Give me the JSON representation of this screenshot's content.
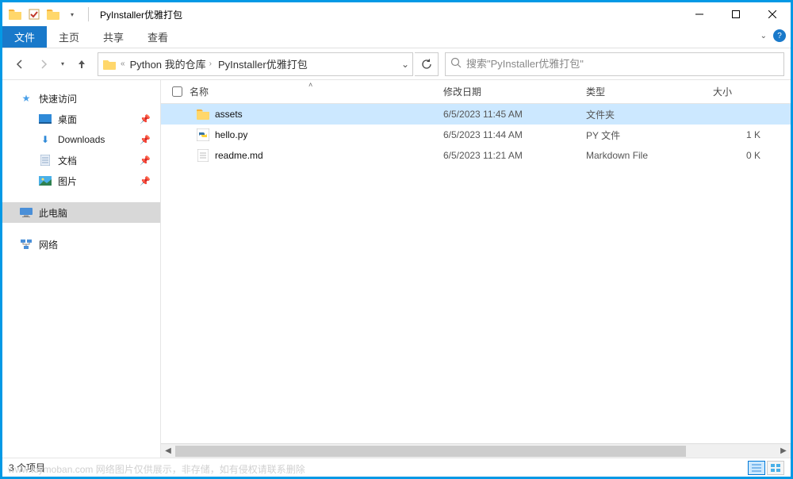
{
  "title": "PyInstaller优雅打包",
  "ribbon": {
    "file": "文件",
    "tabs": [
      "主页",
      "共享",
      "查看"
    ]
  },
  "breadcrumb": {
    "segments": [
      "Python 我的仓库",
      "PyInstaller优雅打包"
    ]
  },
  "search": {
    "placeholder": "搜索\"PyInstaller优雅打包\""
  },
  "sidebar": {
    "quick_access": "快速访问",
    "items_pinned": [
      "桌面",
      "Downloads",
      "文档",
      "图片"
    ],
    "this_pc": "此电脑",
    "network": "网络"
  },
  "columns": {
    "name": "名称",
    "date": "修改日期",
    "type": "类型",
    "size": "大小"
  },
  "rows": [
    {
      "name": "assets",
      "date": "6/5/2023 11:45 AM",
      "type": "文件夹",
      "size": "",
      "kind": "folder",
      "selected": true
    },
    {
      "name": "hello.py",
      "date": "6/5/2023 11:44 AM",
      "type": "PY 文件",
      "size": "1 K",
      "kind": "py",
      "selected": false
    },
    {
      "name": "readme.md",
      "date": "6/5/2023 11:21 AM",
      "type": "Markdown File",
      "size": "0 K",
      "kind": "md",
      "selected": false
    }
  ],
  "status": {
    "count": "3 个项目"
  },
  "watermark": "www.toymoban.com 网络图片仅供展示，非存储，如有侵权请联系删除"
}
